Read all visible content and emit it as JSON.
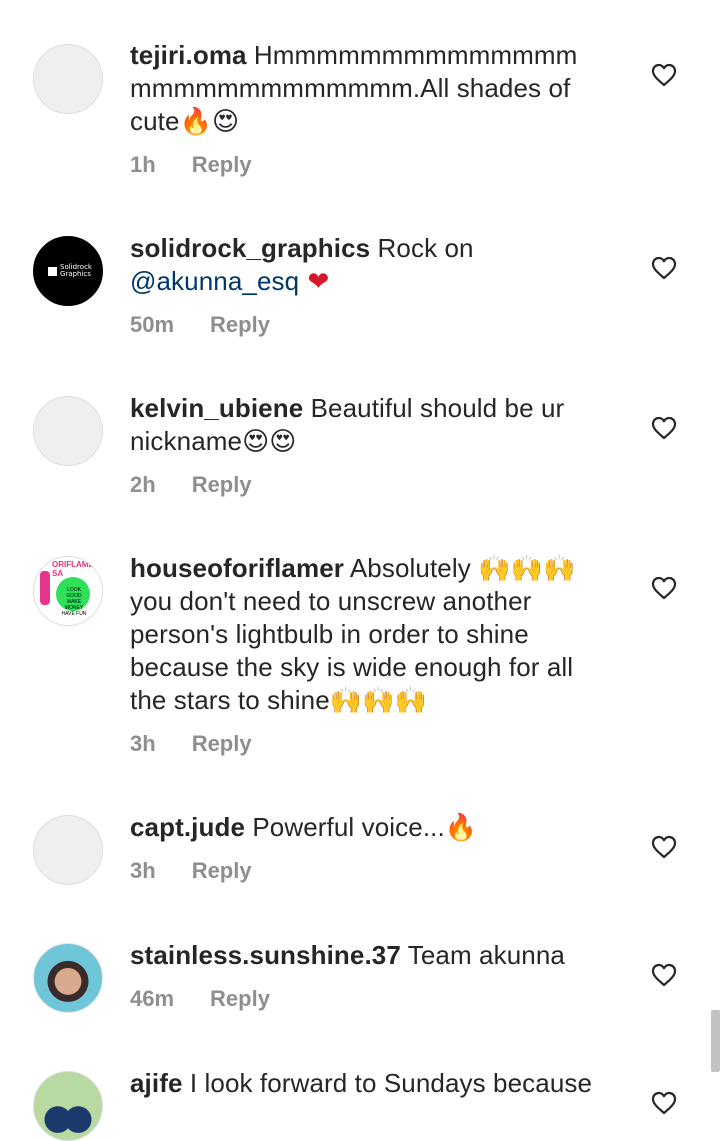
{
  "comments": [
    {
      "username": "tejiri.oma",
      "text_parts": [
        " Hmmmmmmmmmmmmmm mmmmmmmmmmmmm.All shades of cute",
        "🔥😍"
      ],
      "time": "1h",
      "reply_label": "Reply",
      "avatar": "empty"
    },
    {
      "username": "solidrock_graphics",
      "text_before": " Rock on ",
      "mention": "@akunna_esq",
      "text_after": " ❤",
      "time": "50m",
      "reply_label": "Reply",
      "avatar": "solidrock-logo",
      "avatar_text": "Solidrock Graphics"
    },
    {
      "username": "kelvin_ubiene",
      "text": " Beautiful should be ur nickname😍😍",
      "time": "2h",
      "reply_label": "Reply",
      "avatar": "empty"
    },
    {
      "username": "houseoforiflamer",
      "text": " Absolutely 🙌🙌🙌 you don't need to unscrew another person's lightbulb in order to shine because the sky is wide enough for all the stars to shine🙌🙌🙌",
      "time": "3h",
      "reply_label": "Reply",
      "avatar": "oriflame-brand",
      "avatar_banner": "ORIFLAME SA",
      "avatar_badge": "LOOK GOOD MAKE MONEY HAVE FUN"
    },
    {
      "username": "capt.jude",
      "text": " Powerful voice...🔥",
      "time": "3h",
      "reply_label": "Reply",
      "avatar": "empty"
    },
    {
      "username": "stainless.sunshine.37",
      "text": " Team akunna",
      "time": "46m",
      "reply_label": "Reply",
      "avatar": "photo"
    },
    {
      "username": "ajife",
      "text": " I look forward to Sundays because",
      "avatar": "photo-group"
    }
  ],
  "icons": {
    "like": "heart-outline-icon"
  },
  "colors": {
    "text": "#262626",
    "meta": "#8e8e8e",
    "mention": "#00376b",
    "heart_stroke": "#262626"
  }
}
